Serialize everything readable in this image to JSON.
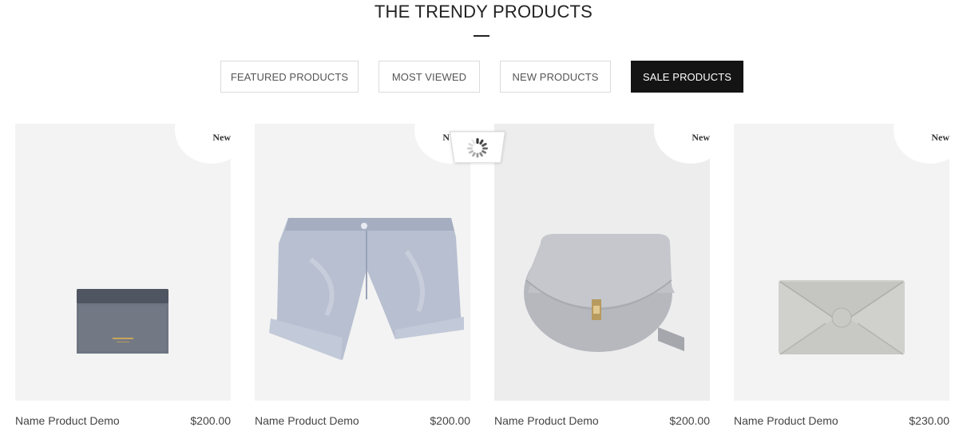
{
  "section": {
    "title": "THE TRENDY PRODUCTS"
  },
  "tabs": [
    {
      "label": "FEATURED PRODUCTS",
      "active": false
    },
    {
      "label": "MOST VIEWED",
      "active": false
    },
    {
      "label": "NEW PRODUCTS",
      "active": false
    },
    {
      "label": "SALE PRODUCTS",
      "active": true
    }
  ],
  "products": [
    {
      "name": "Name Product Demo",
      "price": "$200.00",
      "badge": "New",
      "image": "card-wallet-image"
    },
    {
      "name": "Name Product Demo",
      "price": "$200.00",
      "badge": "N",
      "image": "satin-shorts-image"
    },
    {
      "name": "Name Product Demo",
      "price": "$200.00",
      "badge": "New",
      "image": "round-bag-image"
    },
    {
      "name": "Name Product Demo",
      "price": "$230.00",
      "badge": "New",
      "image": "envelope-clutch-image"
    }
  ],
  "loading_indicator": "spinner-icon",
  "colors": {
    "active_tab": "#141414",
    "thumb_bg": "#f3f3f3",
    "tab_border": "#dcdcdc"
  }
}
